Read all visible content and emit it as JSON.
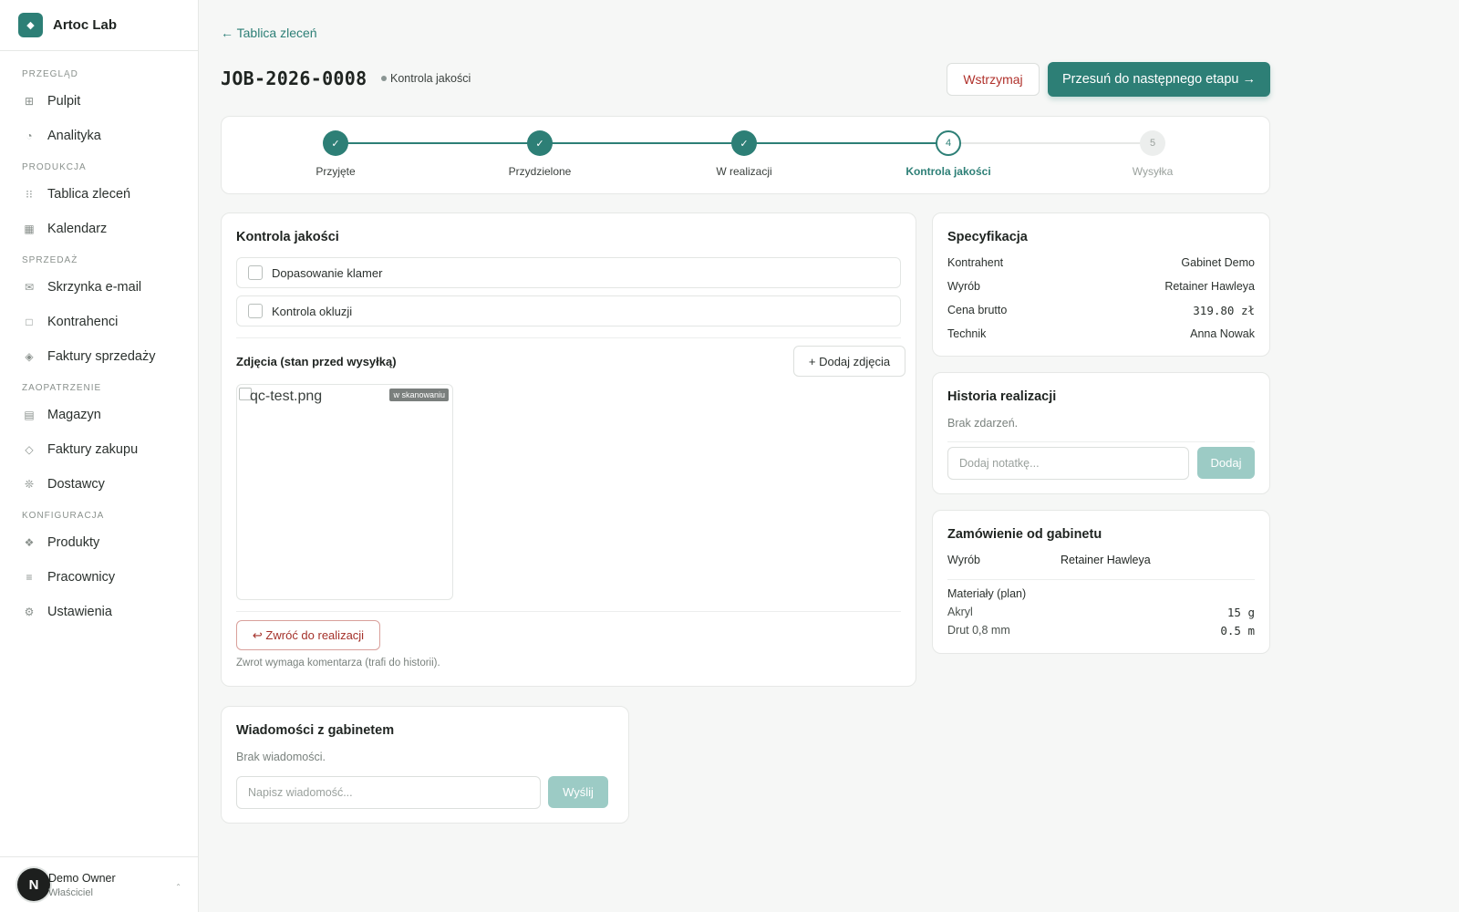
{
  "brand": {
    "logo_glyph": "◆",
    "name": "Artoc Lab"
  },
  "sidebar": {
    "sections": [
      {
        "label": "PRZEGLĄD",
        "items": [
          {
            "label": "Pulpit",
            "icon": "⊞"
          },
          {
            "label": "Analityka",
            "icon": "◔"
          }
        ]
      },
      {
        "label": "PRODUKCJA",
        "items": [
          {
            "label": "Tablica zleceń",
            "icon": "⁝⁝"
          },
          {
            "label": "Kalendarz",
            "icon": "▦"
          }
        ]
      },
      {
        "label": "SPRZEDAŻ",
        "items": [
          {
            "label": "Skrzynka e-mail",
            "icon": "✉"
          },
          {
            "label": "Kontrahenci",
            "icon": "□"
          },
          {
            "label": "Faktury sprzedaży",
            "icon": "◈"
          }
        ]
      },
      {
        "label": "ZAOPATRZENIE",
        "items": [
          {
            "label": "Magazyn",
            "icon": "▤"
          },
          {
            "label": "Faktury zakupu",
            "icon": "◇"
          },
          {
            "label": "Dostawcy",
            "icon": "❊"
          }
        ]
      },
      {
        "label": "KONFIGURACJA",
        "items": [
          {
            "label": "Produkty",
            "icon": "❖"
          },
          {
            "label": "Pracownicy",
            "icon": "≡"
          },
          {
            "label": "Ustawienia",
            "icon": "⚙"
          }
        ]
      }
    ]
  },
  "user": {
    "initial": "N",
    "name": "Demo Owner",
    "role": "Właściciel",
    "chevron": "⌃"
  },
  "header": {
    "back_label": "← Tablica zleceń",
    "job_id": "JOB-2026-0008",
    "stage": "Kontrola jakości",
    "pause_label": "Wstrzymaj",
    "next_label": "Przesuń do następnego etapu →"
  },
  "stepper": {
    "steps": [
      {
        "label": "Przyjęte",
        "state": "done",
        "mark": "✓"
      },
      {
        "label": "Przydzielone",
        "state": "done",
        "mark": "✓"
      },
      {
        "label": "W realizacji",
        "state": "done",
        "mark": "✓"
      },
      {
        "label": "Kontrola jakości",
        "state": "current",
        "mark": "4"
      },
      {
        "label": "Wysyłka",
        "state": "future",
        "mark": "5"
      }
    ]
  },
  "qc": {
    "title": "Kontrola jakości",
    "checks": [
      {
        "label": "Dopasowanie klamer"
      },
      {
        "label": "Kontrola okluzji"
      }
    ],
    "photos_label": "Zdjęcia (stan przed wysyłką)",
    "add_photos_label": "+ Dodaj zdjęcia",
    "photo": {
      "name": "qc-test.png",
      "tag": "w skanowaniu"
    },
    "return_label": "↩ Zwróć do realizacji",
    "return_note": "Zwrot wymaga komentarza (trafi do historii)."
  },
  "spec": {
    "title": "Specyfikacja",
    "rows": [
      {
        "label": "Kontrahent",
        "value": "Gabinet Demo"
      },
      {
        "label": "Wyrób",
        "value": "Retainer Hawleya"
      },
      {
        "label": "Cena brutto",
        "value": "319.80 zł"
      },
      {
        "label": "Technik",
        "value": "Anna Nowak"
      }
    ]
  },
  "history": {
    "title": "Historia realizacji",
    "empty": "Brak zdarzeń.",
    "note_placeholder": "Dodaj notatkę...",
    "add_label": "Dodaj"
  },
  "order": {
    "title": "Zamówienie od gabinetu",
    "product_label": "Wyrób",
    "product_value": "Retainer Hawleya",
    "materials_label": "Materiały (plan)",
    "materials": [
      {
        "name": "Akryl",
        "qty": "15 g"
      },
      {
        "name": "Drut 0,8 mm",
        "qty": "0.5 m"
      }
    ]
  },
  "messages": {
    "title": "Wiadomości z gabinetem",
    "empty": "Brak wiadomości.",
    "placeholder": "Napisz wiadomość...",
    "send_label": "Wyślij"
  },
  "colors": {
    "accent": "#2d7f76",
    "danger": "#b0312b",
    "accent_light": "#9ccbc5"
  }
}
